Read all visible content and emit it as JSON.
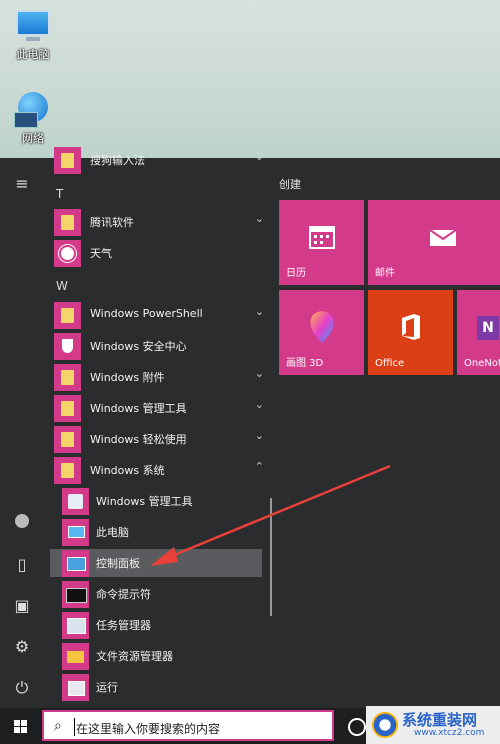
{
  "desktop": {
    "icons": [
      {
        "label": "此电脑",
        "icon": "computer-icon"
      },
      {
        "label": "网络",
        "icon": "network-icon"
      }
    ]
  },
  "startmenu": {
    "top_partial": {
      "label": "搜狗输入法"
    },
    "section_t": "T",
    "apps_t": [
      {
        "label": "腾讯软件",
        "icon": "folder-icon",
        "expandable": true
      },
      {
        "label": "天气",
        "icon": "weather-sun-icon",
        "expandable": false
      }
    ],
    "section_w": "W",
    "apps_w": [
      {
        "label": "Windows PowerShell",
        "icon": "folder-icon",
        "expandable": true
      },
      {
        "label": "Windows 安全中心",
        "icon": "shield-icon",
        "expandable": false
      },
      {
        "label": "Windows 附件",
        "icon": "folder-icon",
        "expandable": true
      },
      {
        "label": "Windows 管理工具",
        "icon": "folder-icon",
        "expandable": true
      },
      {
        "label": "Windows 轻松使用",
        "icon": "folder-icon",
        "expandable": true
      },
      {
        "label": "Windows 系统",
        "icon": "folder-icon",
        "expandable": true,
        "expanded": true
      }
    ],
    "system_sub": [
      {
        "label": "Windows 管理工具",
        "icon": "admin-tools-icon"
      },
      {
        "label": "此电脑",
        "icon": "computer-icon"
      },
      {
        "label": "控制面板",
        "icon": "control-panel-icon",
        "highlighted": true
      },
      {
        "label": "命令提示符",
        "icon": "cmd-icon"
      },
      {
        "label": "任务管理器",
        "icon": "task-manager-icon"
      },
      {
        "label": "文件资源管理器",
        "icon": "file-explorer-icon"
      },
      {
        "label": "运行",
        "icon": "run-icon"
      }
    ],
    "rail": [
      {
        "icon": "hamburger-menu-icon"
      },
      {
        "icon": "user-icon"
      },
      {
        "icon": "document-icon"
      },
      {
        "icon": "pictures-icon"
      },
      {
        "icon": "settings-icon"
      },
      {
        "icon": "power-icon"
      }
    ]
  },
  "tiles": {
    "group_title": "创建",
    "items": [
      {
        "label": "日历",
        "icon": "calendar-icon",
        "color": "#d43a8a"
      },
      {
        "label": "邮件",
        "icon": "mail-icon",
        "color": "#d43a8a"
      },
      {
        "label": "画图 3D",
        "icon": "paint3d-icon",
        "color": "#d43a8a"
      },
      {
        "label": "Office",
        "icon": "office-icon",
        "color": "#dc3e15"
      },
      {
        "label": "OneNot",
        "icon": "onenote-icon",
        "color": "#d43a8a"
      }
    ]
  },
  "taskbar": {
    "search_placeholder": "在这里输入你要搜索的内容",
    "start_icon": "windows-logo-icon",
    "search_icon": "search-icon"
  },
  "watermark": {
    "text": "系统重装网",
    "url": "www.xtcz2.com"
  },
  "accent_color": "#d43a8a",
  "annotation_color": "#e8413a"
}
